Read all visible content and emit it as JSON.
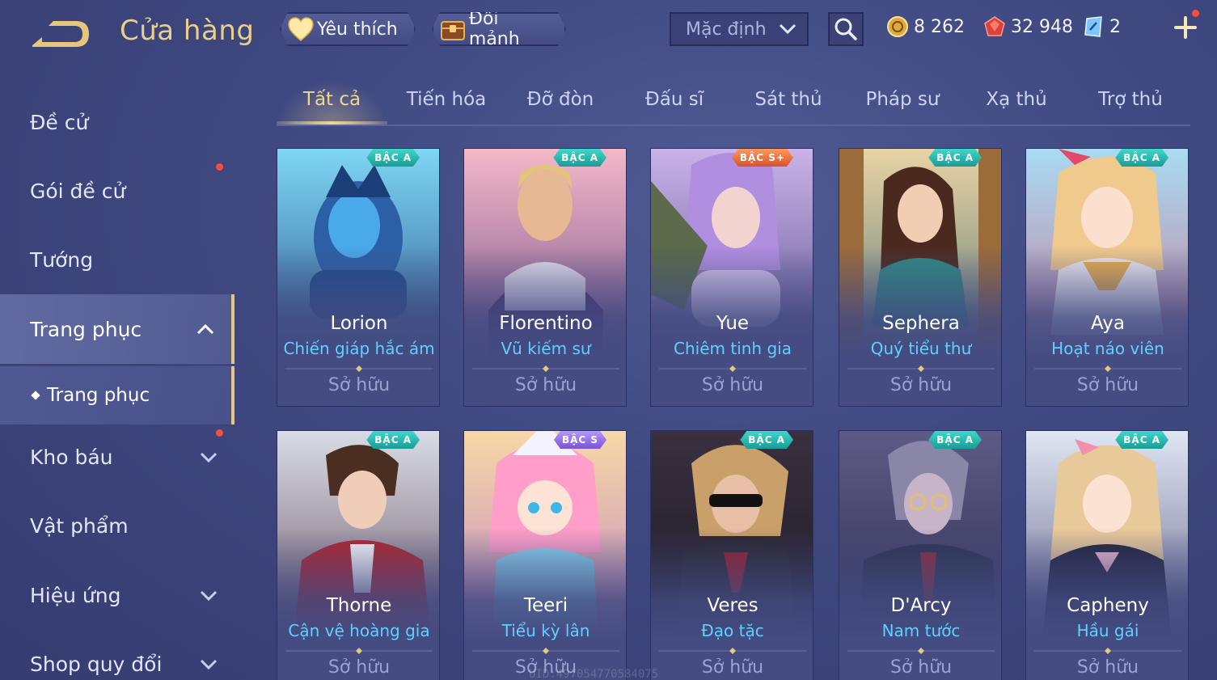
{
  "header": {
    "title": "Cửa hàng",
    "favorites_label": "Yêu thích",
    "exchange_label": "Đổi mảnh",
    "sort_value": "Mặc định",
    "currencies": {
      "gold": "8 262",
      "ruby": "32 948",
      "voucher": "2"
    }
  },
  "sidebar": {
    "items": [
      {
        "label": "Đề cử"
      },
      {
        "label": "Gói đề cử"
      },
      {
        "label": "Tướng"
      },
      {
        "label": "Trang phục"
      },
      {
        "label": "Kho báu"
      },
      {
        "label": "Vật phẩm"
      },
      {
        "label": "Hiệu ứng"
      },
      {
        "label": "Shop quy đổi"
      }
    ],
    "sub_item": "Trang phục"
  },
  "tabs": [
    "Tất cả",
    "Tiến hóa",
    "Đỡ đòn",
    "Đấu sĩ",
    "Sát thủ",
    "Pháp sư",
    "Xạ thủ",
    "Trợ thủ"
  ],
  "cards": [
    {
      "hero": "Lorion",
      "skin": "Chiến giáp hắc ám",
      "tier": "BẬC A",
      "status": "Sở hữu"
    },
    {
      "hero": "Florentino",
      "skin": "Vũ kiếm sư",
      "tier": "BẬC A",
      "status": "Sở hữu"
    },
    {
      "hero": "Yue",
      "skin": "Chiêm tinh gia",
      "tier": "BẬC S+",
      "status": "Sở hữu"
    },
    {
      "hero": "Sephera",
      "skin": "Quý tiểu thư",
      "tier": "BẬC A",
      "status": "Sở hữu"
    },
    {
      "hero": "Aya",
      "skin": "Hoạt náo viên",
      "tier": "BẬC A",
      "status": "Sở hữu"
    },
    {
      "hero": "Thorne",
      "skin": "Cận vệ hoàng gia",
      "tier": "BẬC A",
      "status": "Sở hữu"
    },
    {
      "hero": "Teeri",
      "skin": "Tiểu kỳ lân",
      "tier": "BẬC S",
      "status": "Sở hữu"
    },
    {
      "hero": "Veres",
      "skin": "Đạo tặc",
      "tier": "BẬC A",
      "status": "Sở hữu"
    },
    {
      "hero": "D'Arcy",
      "skin": "Nam tước",
      "tier": "BẬC A",
      "status": "Sở hữu"
    },
    {
      "hero": "Capheny",
      "skin": "Hầu gái",
      "tier": "BẬC A",
      "status": "Sở hữu"
    }
  ],
  "watermark": "UID:497054770584075",
  "colors": {
    "accent_gold": "#e9cf8e",
    "skin_name_blue": "#5fd1ff",
    "tier_a": "#2bbcb0",
    "tier_s": "#9b78f0",
    "tier_splus": "#ef7542",
    "notification_red": "#ff4b3e"
  }
}
